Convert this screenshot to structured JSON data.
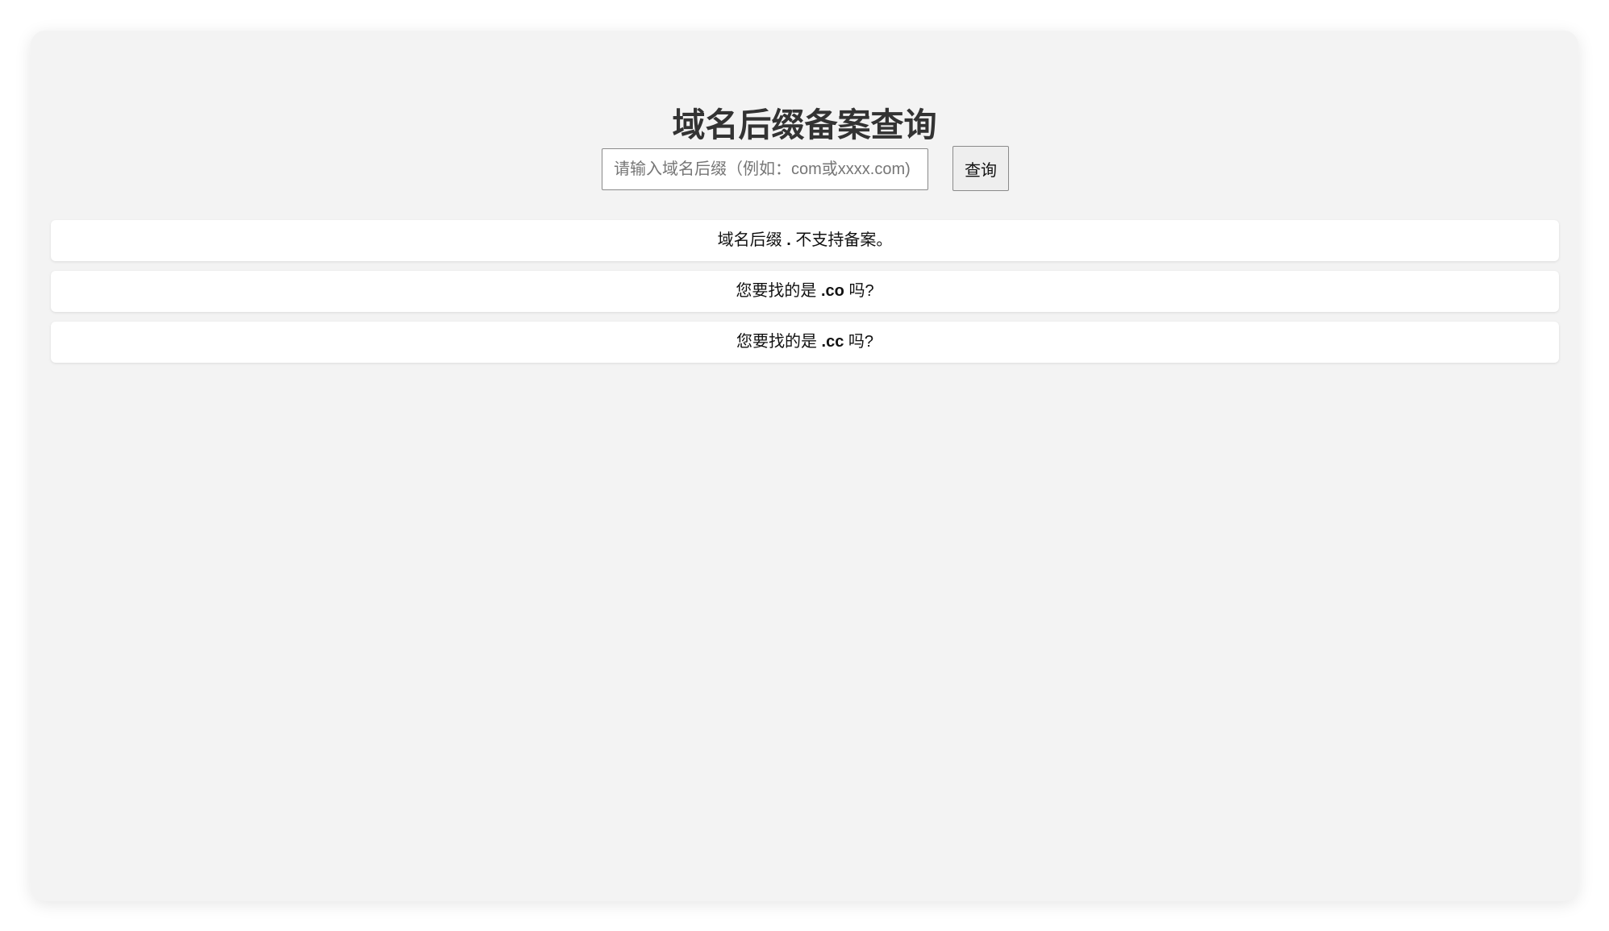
{
  "page": {
    "title": "域名后缀备案查询"
  },
  "search": {
    "placeholder": "请输入域名后缀（例如：com或xxxx.com)",
    "value": "",
    "button_label": "查询"
  },
  "results": [
    {
      "prefix": "域名后缀",
      "suffix": ".",
      "postfix": "不支持备案。"
    },
    {
      "prefix": "您要找的是",
      "suffix": ".co",
      "postfix": "吗?"
    },
    {
      "prefix": "您要找的是",
      "suffix": ".cc",
      "postfix": "吗?"
    }
  ],
  "colors": {
    "panel_background": "#f3f3f3",
    "result_background": "#ffffff",
    "title_text": "#333333"
  }
}
